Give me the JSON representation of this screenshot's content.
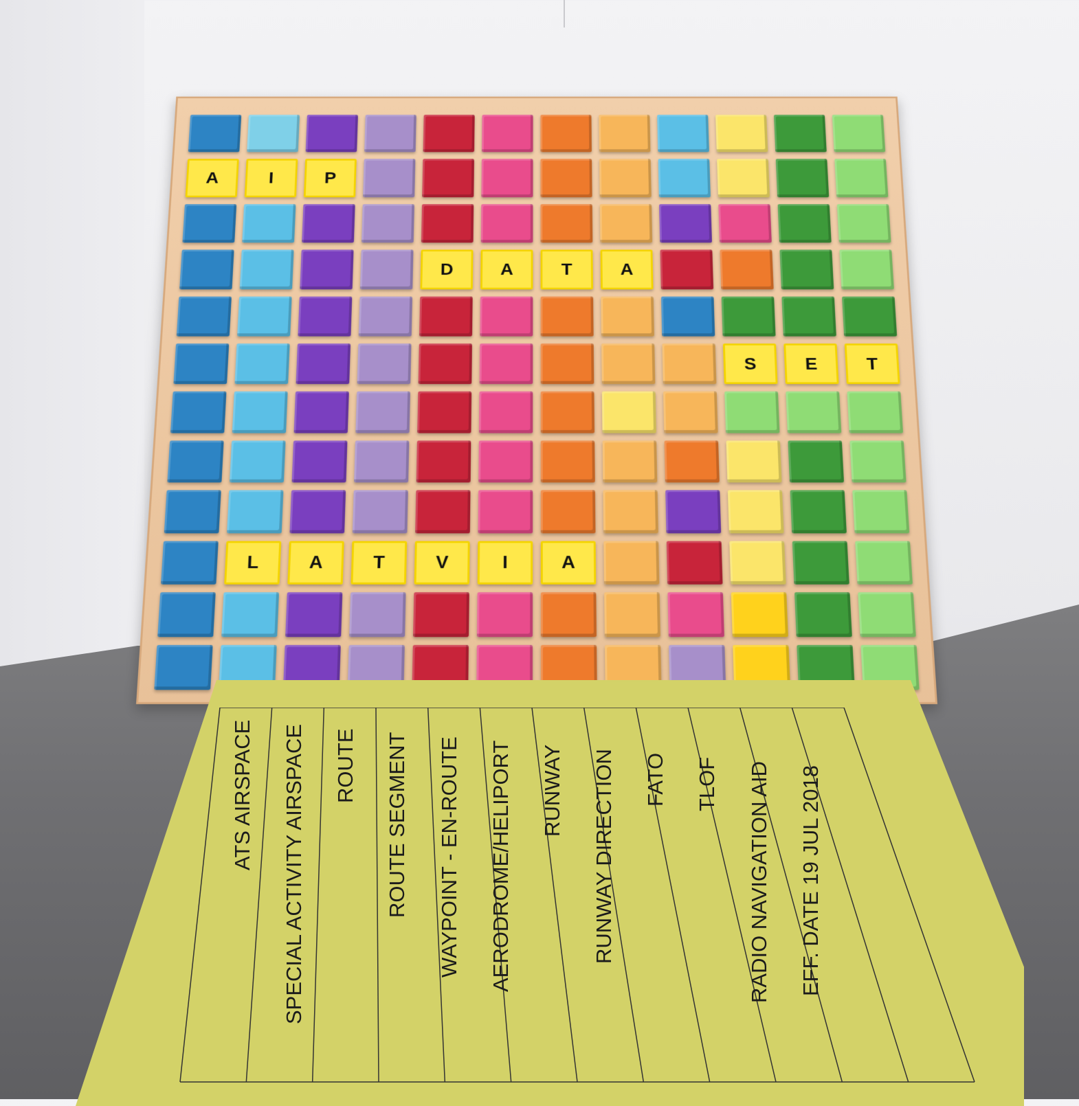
{
  "board": {
    "rows": [
      [
        "#2d84c4",
        "#7fd0e8",
        "#7a3fbf",
        "#a78fca",
        "#c8243a",
        "#e94c8c",
        "#ee7a2c",
        "#f7b65a",
        "#5bbfe6",
        "#fbe56a",
        "#3d9a3a",
        "#8fdc75"
      ],
      [
        "A",
        "I",
        "P",
        "#a78fca",
        "#c8243a",
        "#e94c8c",
        "#ee7a2c",
        "#f7b65a",
        "#5bbfe6",
        "#fbe56a",
        "#3d9a3a",
        "#8fdc75"
      ],
      [
        "#2d84c4",
        "#5bbfe6",
        "#7a3fbf",
        "#a78fca",
        "#c8243a",
        "#e94c8c",
        "#ee7a2c",
        "#f7b65a",
        "#7a3fbf",
        "#e94c8c",
        "#3d9a3a",
        "#8fdc75"
      ],
      [
        "#2d84c4",
        "#5bbfe6",
        "#7a3fbf",
        "#a78fca",
        "D",
        "A",
        "T",
        "A",
        "#c8243a",
        "#ee7a2c",
        "#3d9a3a",
        "#8fdc75"
      ],
      [
        "#2d84c4",
        "#5bbfe6",
        "#7a3fbf",
        "#a78fca",
        "#c8243a",
        "#e94c8c",
        "#ee7a2c",
        "#f7b65a",
        "#2d84c4",
        "#3d9a3a",
        "#3d9a3a",
        "#3d9a3a"
      ],
      [
        "#2d84c4",
        "#5bbfe6",
        "#7a3fbf",
        "#a78fca",
        "#c8243a",
        "#e94c8c",
        "#ee7a2c",
        "#f7b65a",
        "#f7b65a",
        "S",
        "E",
        "T"
      ],
      [
        "#2d84c4",
        "#5bbfe6",
        "#7a3fbf",
        "#a78fca",
        "#c8243a",
        "#e94c8c",
        "#ee7a2c",
        "#fbe56a",
        "#f7b65a",
        "#8fdc75",
        "#8fdc75",
        "#8fdc75"
      ],
      [
        "#2d84c4",
        "#5bbfe6",
        "#7a3fbf",
        "#a78fca",
        "#c8243a",
        "#e94c8c",
        "#ee7a2c",
        "#f7b65a",
        "#ee7a2c",
        "#fbe56a",
        "#3d9a3a",
        "#8fdc75"
      ],
      [
        "#2d84c4",
        "#5bbfe6",
        "#7a3fbf",
        "#a78fca",
        "#c8243a",
        "#e94c8c",
        "#ee7a2c",
        "#f7b65a",
        "#7a3fbf",
        "#fbe56a",
        "#3d9a3a",
        "#8fdc75"
      ],
      [
        "#2d84c4",
        "L",
        "A",
        "T",
        "V",
        "I",
        "A",
        "#f7b65a",
        "#c8243a",
        "#fbe56a",
        "#3d9a3a",
        "#8fdc75"
      ],
      [
        "#2d84c4",
        "#5bbfe6",
        "#7a3fbf",
        "#a78fca",
        "#c8243a",
        "#e94c8c",
        "#ee7a2c",
        "#f7b65a",
        "#e94c8c",
        "#ffd21c",
        "#3d9a3a",
        "#8fdc75"
      ],
      [
        "#2d84c4",
        "#5bbfe6",
        "#7a3fbf",
        "#a78fca",
        "#c8243a",
        "#e94c8c",
        "#ee7a2c",
        "#f7b65a",
        "#a78fca",
        "#ffd21c",
        "#3d9a3a",
        "#8fdc75"
      ]
    ]
  },
  "sheet": {
    "columns": [
      "ATS AIRSPACE",
      "SPECIAL ACTIVITY AIRSPACE",
      "ROUTE",
      "ROUTE SEGMENT",
      "WAYPOINT - EN-ROUTE",
      "AERODROME/HELIPORT",
      "RUNWAY",
      "RUNWAY DIRECTION",
      "FATO",
      "TLOF",
      "RADIO NAVIGATION AID",
      "EFF. DATE 19 JUL 2018"
    ]
  },
  "colors": {
    "sheet": "#d3d268",
    "board_wood": "#e8c199",
    "letter_tile": "#ffe84a"
  }
}
